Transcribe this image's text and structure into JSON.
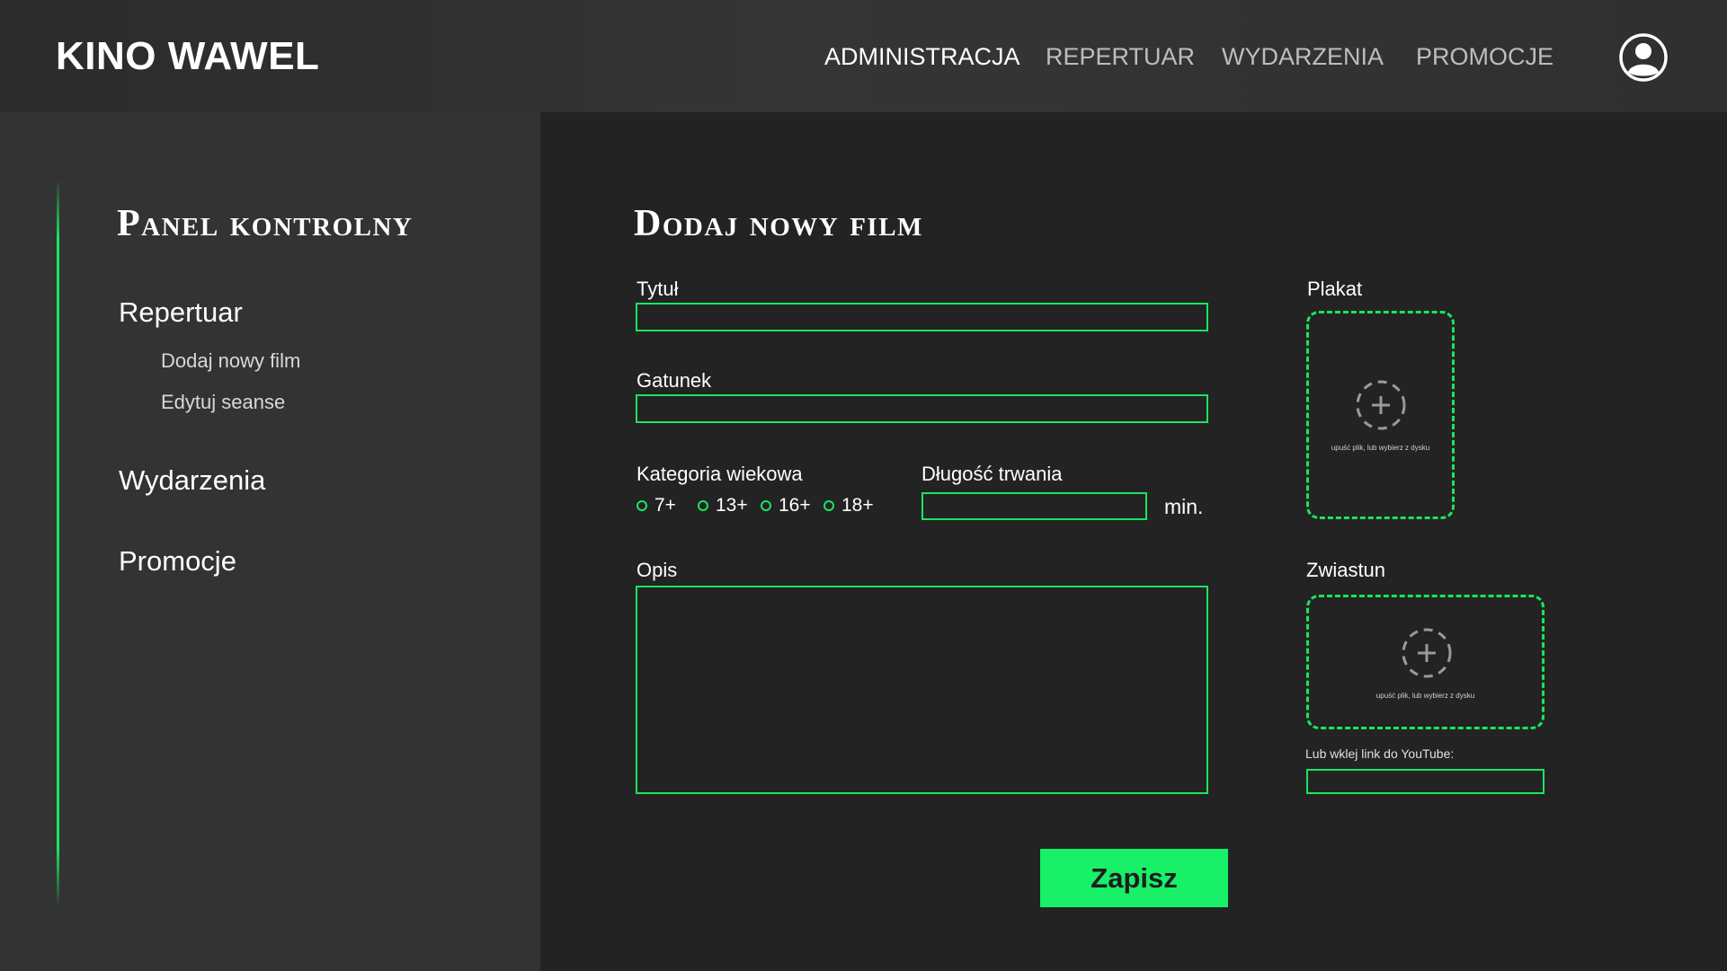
{
  "header": {
    "brand": "KINO WAWEL",
    "nav": [
      {
        "label": "ADMINISTRACJA",
        "active": true
      },
      {
        "label": "REPERTUAR",
        "active": false
      },
      {
        "label": "WYDARZENIA",
        "active": false
      },
      {
        "label": "PROMOCJE",
        "active": false
      }
    ],
    "user_icon": "user-circle-icon"
  },
  "sidebar": {
    "title": "Panel kontrolny",
    "sections": [
      {
        "label": "Repertuar",
        "children": [
          {
            "label": "Dodaj nowy film"
          },
          {
            "label": "Edytuj seanse"
          }
        ]
      },
      {
        "label": "Wydarzenia",
        "children": []
      },
      {
        "label": "Promocje",
        "children": []
      }
    ]
  },
  "form": {
    "title": "Dodaj nowy film",
    "title_field": {
      "label": "Tytuł",
      "value": ""
    },
    "genre_field": {
      "label": "Gatunek",
      "value": ""
    },
    "age_category": {
      "label": "Kategoria wiekowa",
      "options": [
        "7+",
        "13+",
        "16+",
        "18+"
      ],
      "selected": null
    },
    "duration": {
      "label": "Długość trwania",
      "value": "",
      "unit": "min."
    },
    "description": {
      "label": "Opis",
      "value": ""
    },
    "poster": {
      "label": "Plakat",
      "hint": "upuść plik, lub wybierz z dysku",
      "icon": "add-plus-icon"
    },
    "trailer": {
      "label": "Zwiastun",
      "hint": "upuść plik, lub wybierz z dysku",
      "icon": "add-plus-icon",
      "youtube_label": "Lub wklej link do YouTube:",
      "youtube_value": ""
    },
    "save_label": "Zapisz"
  },
  "colors": {
    "accent": "#18e660",
    "button": "#18f068",
    "sidebar_bg": "#333333",
    "main_bg": "#232323"
  }
}
